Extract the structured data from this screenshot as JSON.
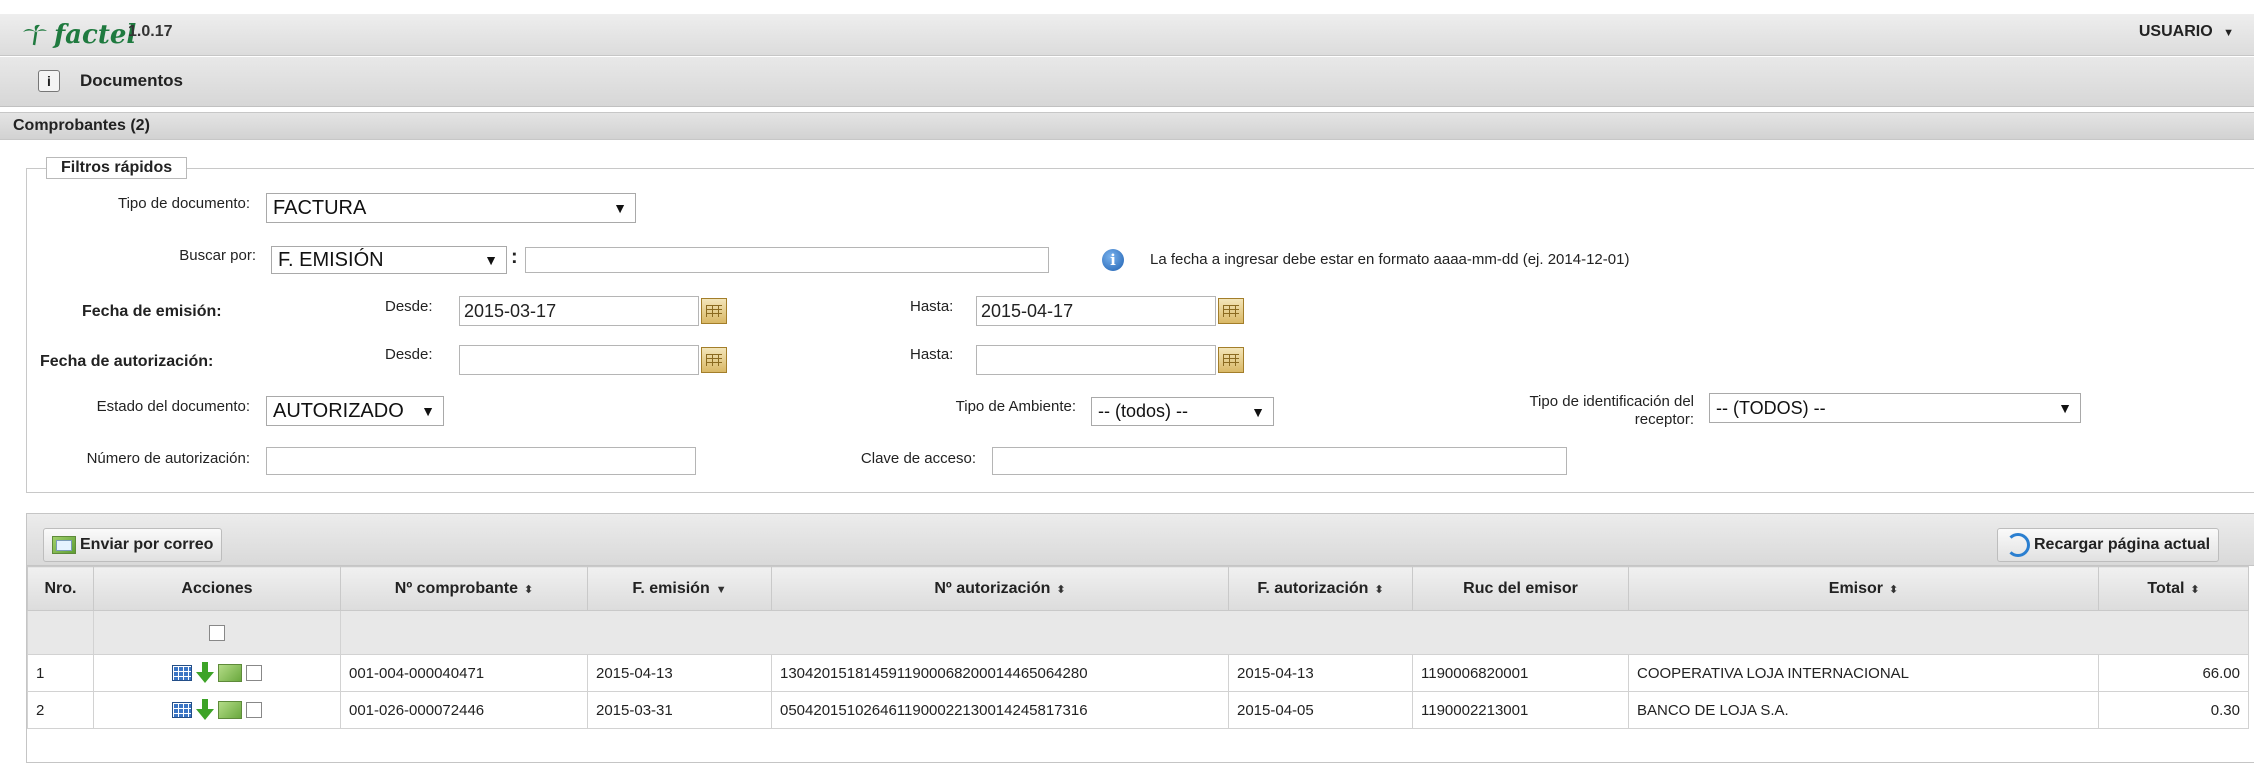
{
  "app": {
    "name": "factel",
    "version": "1.0.17",
    "user_menu": "USUARIO"
  },
  "nav": {
    "documents_label": "Documentos"
  },
  "section": {
    "title": "Comprobantes (2)"
  },
  "filters": {
    "legend": "Filtros rápidos",
    "doc_type_label": "Tipo de documento:",
    "doc_type_value": "FACTURA",
    "search_by_label": "Buscar por:",
    "search_by_value": "F. EMISIÓN",
    "search_colon": ":",
    "search_value": "",
    "date_hint": "La fecha a ingresar debe estar en formato aaaa-mm-dd (ej. 2014-12-01)",
    "emission_label": "Fecha de emisión:",
    "authorization_label": "Fecha de autorización:",
    "from_label": "Desde:",
    "to_label": "Hasta:",
    "emission_from": "2015-03-17",
    "emission_to": "2015-04-17",
    "authorization_from": "",
    "authorization_to": "",
    "status_label": "Estado del documento:",
    "status_value": "AUTORIZADO",
    "environment_label": "Tipo de Ambiente:",
    "environment_value": "-- (todos) --",
    "receiver_id_label_1": "Tipo de identificación del",
    "receiver_id_label_2": "receptor:",
    "receiver_id_value": "-- (TODOS) --",
    "auth_number_label": "Número de autorización:",
    "auth_number_value": "",
    "access_key_label": "Clave de acceso:",
    "access_key_value": ""
  },
  "toolbar": {
    "send_email": "Enviar por correo",
    "reload": "Recargar página actual"
  },
  "table": {
    "headers": [
      "Nro.",
      "Acciones",
      "Nº comprobante",
      "F. emisión",
      "Nº autorización",
      "F. autorización",
      "Ruc del emisor",
      "Emisor",
      "Total"
    ],
    "rows": [
      [
        "1",
        "",
        "001-004-000040471",
        "2015-04-13",
        "1304201518145911900068200014465064280",
        "2015-04-13",
        "1190006820001",
        "COOPERATIVA LOJA INTERNACIONAL",
        "66.00"
      ],
      [
        "2",
        "",
        "001-026-000072446",
        "2015-03-31",
        "0504201510264611900022130014245817316",
        "2015-04-05",
        "1190002213001",
        "BANCO DE LOJA S.A.",
        "0.30"
      ]
    ]
  },
  "icons": {
    "logo": "palm-tree-icon",
    "calendar": "calendar-icon",
    "info": "info-icon",
    "view": "view-grid-icon",
    "download": "download-arrow-icon",
    "email": "email-icon",
    "reload": "reload-icon"
  }
}
